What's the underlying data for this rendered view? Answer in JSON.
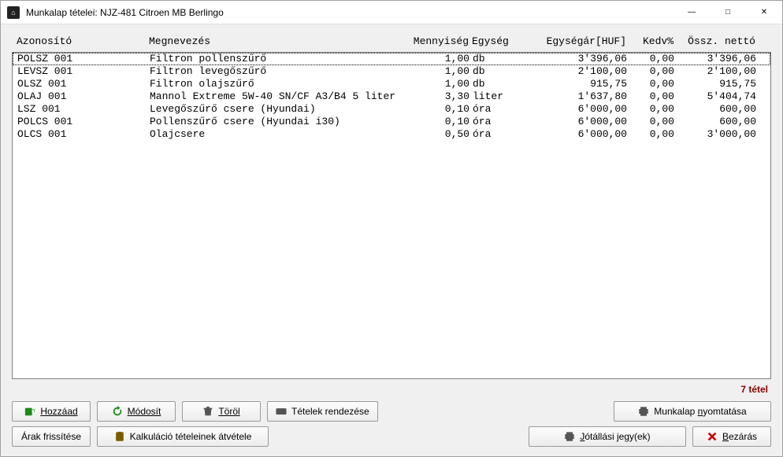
{
  "window": {
    "title": "Munkalap tételei: NJZ-481 Citroen MB Berlingo"
  },
  "columns": {
    "id": "Azonosító",
    "name": "Megnevezés",
    "qty": "Mennyiség",
    "unit": "Egység",
    "price": "Egységár[HUF]",
    "disc": "Kedv%",
    "net": "Össz. nettó"
  },
  "rows": [
    {
      "id": "POLSZ 001",
      "name": "Filtron pollenszűrő",
      "qty": "1,00",
      "unit": "db",
      "price": "3'396,06",
      "disc": "0,00",
      "net": "3'396,06",
      "selected": true
    },
    {
      "id": "LEVSZ 001",
      "name": "Filtron levegőszűrő",
      "qty": "1,00",
      "unit": "db",
      "price": "2'100,00",
      "disc": "0,00",
      "net": "2'100,00"
    },
    {
      "id": "OLSZ 001",
      "name": "Filtron olajszűrő",
      "qty": "1,00",
      "unit": "db",
      "price": "915,75",
      "disc": "0,00",
      "net": "915,75"
    },
    {
      "id": "OLAJ 001",
      "name": "Mannol Extreme 5W-40 SN/CF A3/B4 5 liter",
      "qty": "3,30",
      "unit": "liter",
      "price": "1'637,80",
      "disc": "0,00",
      "net": "5'404,74"
    },
    {
      "id": "LSZ 001",
      "name": "Levegőszűrő csere (Hyundai)",
      "qty": "0,10",
      "unit": "óra",
      "price": "6'000,00",
      "disc": "0,00",
      "net": "600,00"
    },
    {
      "id": "POLCS 001",
      "name": "Pollenszűrő csere (Hyundai i30)",
      "qty": "0,10",
      "unit": "óra",
      "price": "6'000,00",
      "disc": "0,00",
      "net": "600,00"
    },
    {
      "id": "OLCS 001",
      "name": "Olajcsere",
      "qty": "0,50",
      "unit": "óra",
      "price": "6'000,00",
      "disc": "0,00",
      "net": "3'000,00"
    }
  ],
  "count_label": "7 tétel",
  "buttons": {
    "add": "Hozzáad",
    "edit": "Módosít",
    "delete": "Töröl",
    "sort": "Tételek rendezése",
    "print_worksheet": "Munkalap nyomtatása",
    "price_refresh": "Árak frissítése",
    "calc_adopt": "Kalkuláció tételeinek átvétele",
    "warranty": "Jótállási jegy(ek)",
    "close": "Bezárás"
  }
}
